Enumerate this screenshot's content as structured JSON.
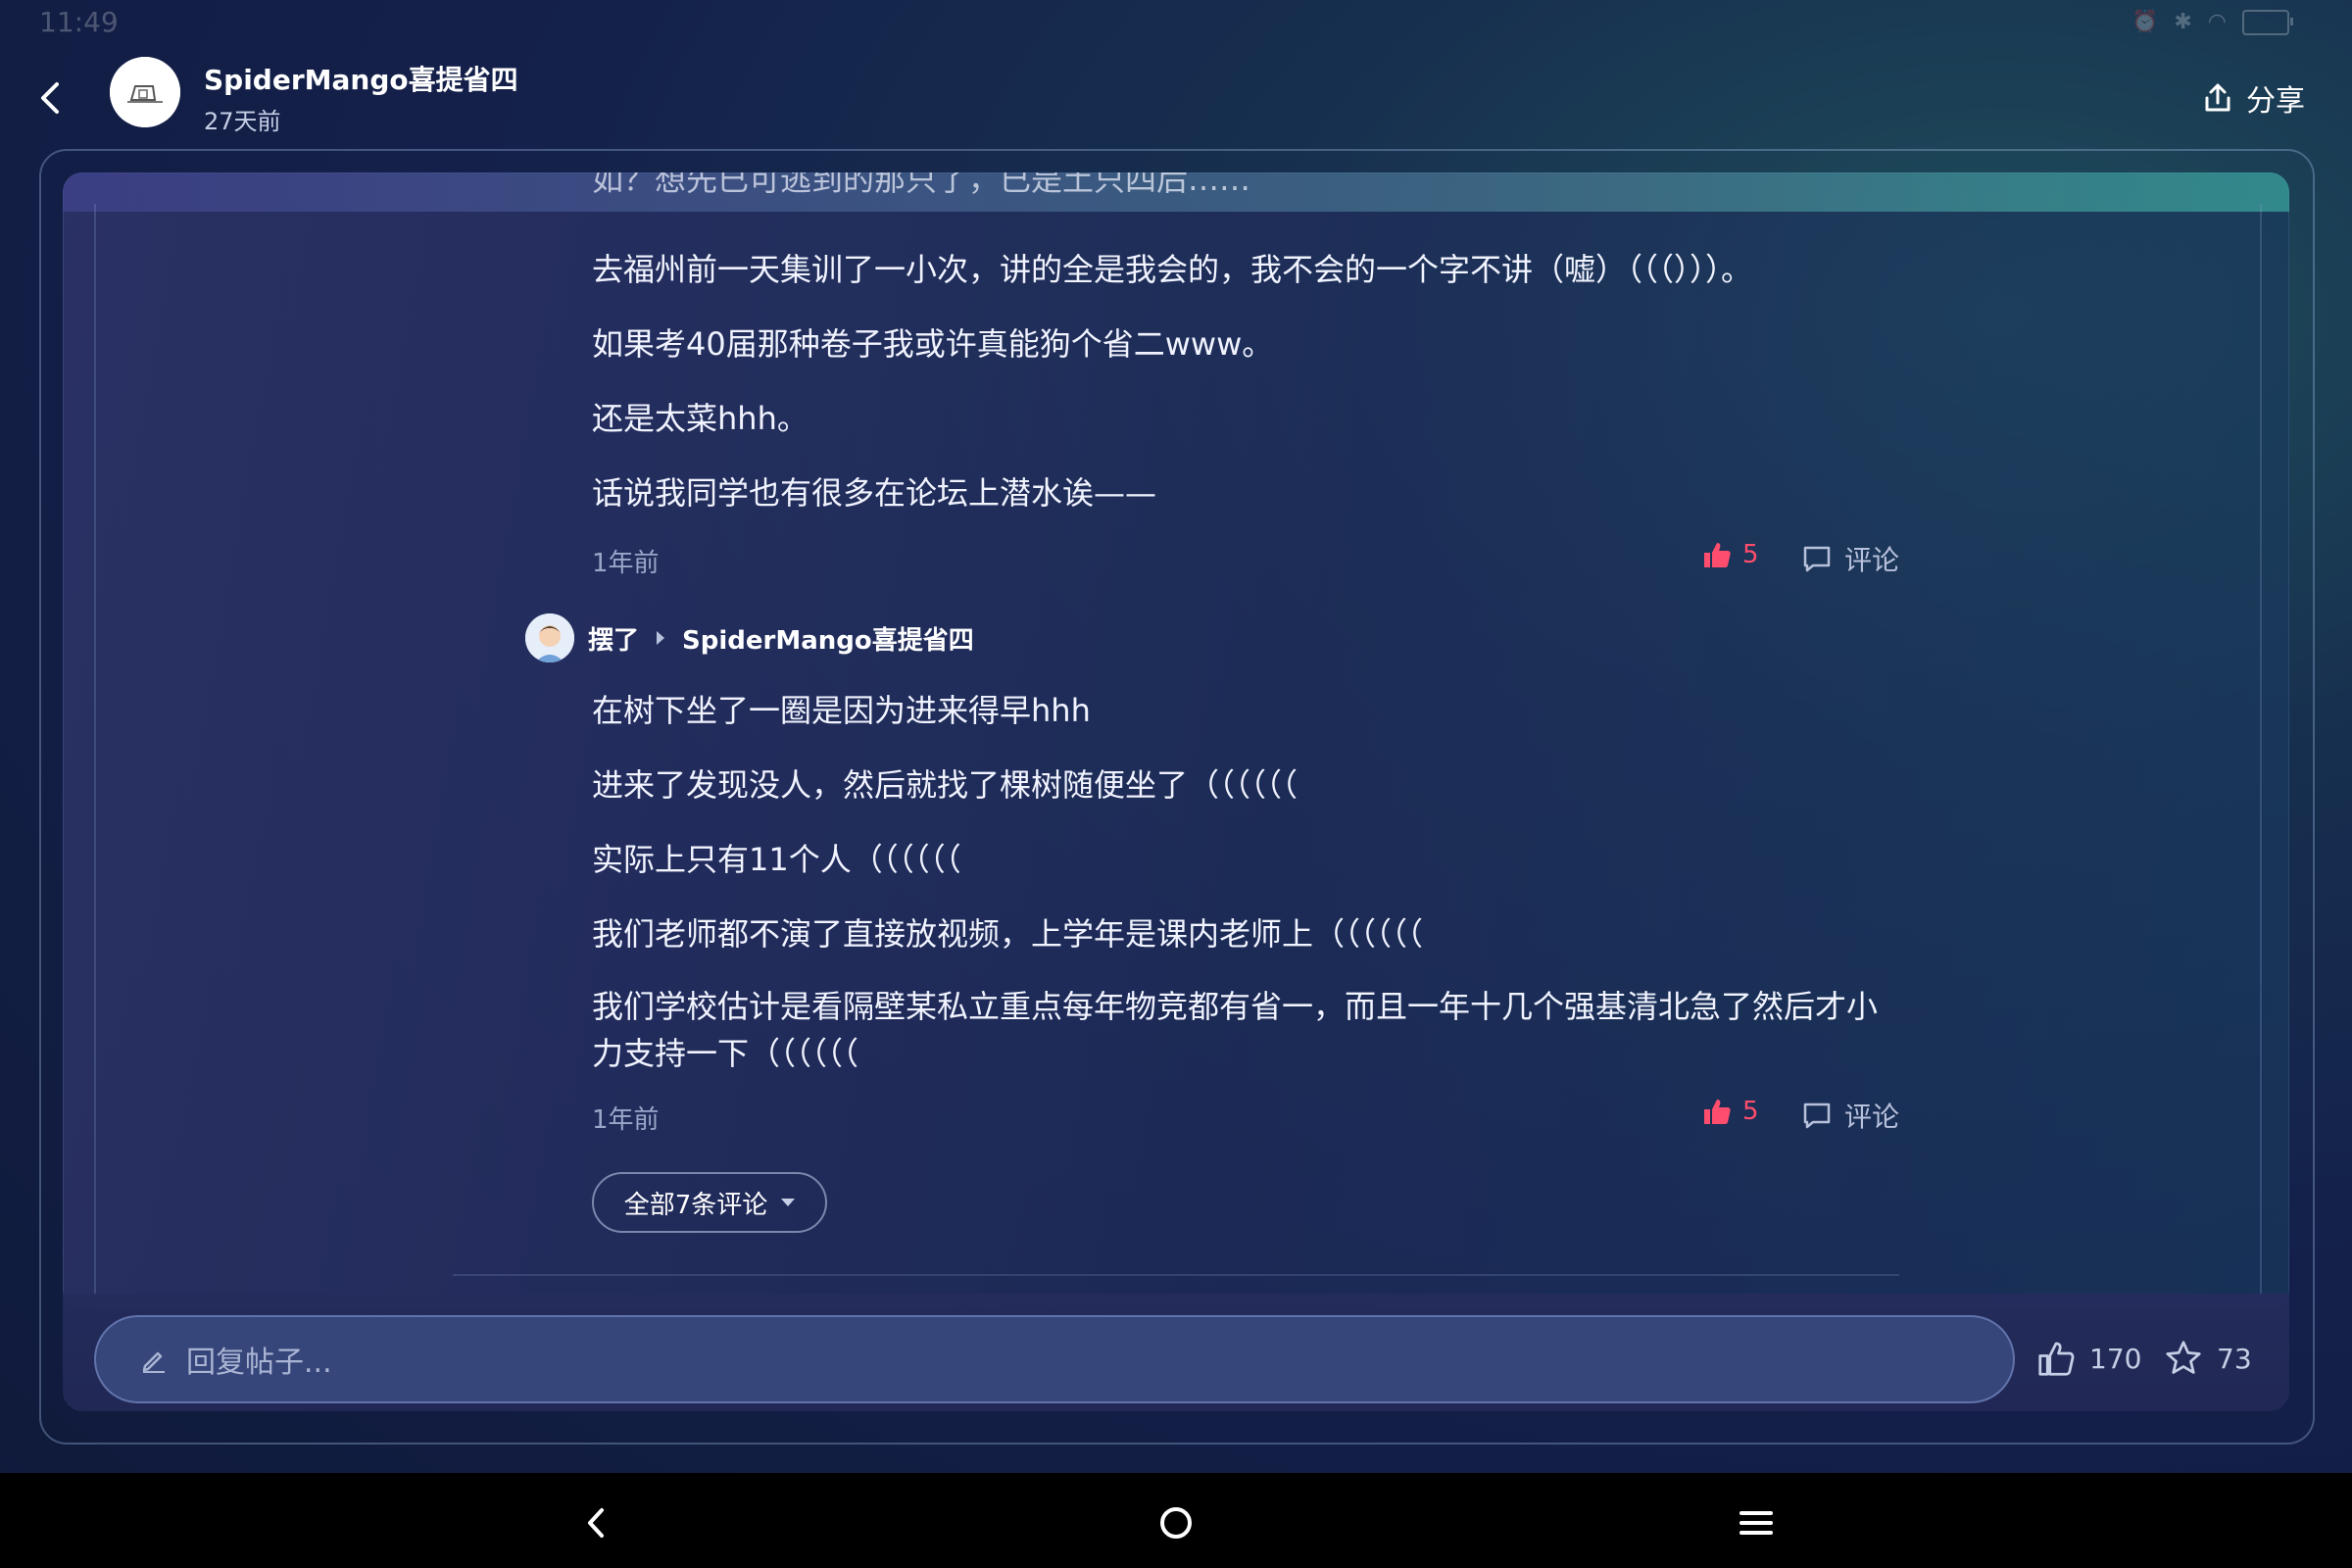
{
  "status": {
    "time": "11:49"
  },
  "header": {
    "author": "SpiderMango喜提省四",
    "time_ago": "27天前",
    "share_label": "分享"
  },
  "comment1": {
    "cut_line": "如？想先已可逃到的那只了，已是土只四后……",
    "lines": [
      "去福州前一天集训了一小次，讲的全是我会的，我不会的一个字不讲（嘘）（（（）））。",
      "如果考40届那种卷子我或许真能狗个省二www。",
      "还是太菜hhh。",
      "话说我同学也有很多在论坛上潜水诶——"
    ],
    "time": "1年前",
    "likes": "5",
    "comment_label": "评论"
  },
  "comment2": {
    "user": "摆了",
    "reply_to": "SpiderMango喜提省四",
    "lines": [
      "在树下坐了一圈是因为进来得早hhh",
      "进来了发现没人，然后就找了棵树随便坐了（（（（（（",
      "实际上只有11个人（（（（（（",
      "我们老师都不演了直接放视频，上学年是课内老师上（（（（（（",
      "我们学校估计是看隔壁某私立重点每年物竞都有省一，而且一年十几个强基清北急了然后才小",
      "力支持一下（（（（（（"
    ],
    "time": "1年前",
    "likes": "5",
    "comment_label": "评论"
  },
  "all_comments_label": "全部7条评论",
  "bottom": {
    "reply_placeholder": "回复帖子...",
    "like_count": "170",
    "star_count": "73"
  },
  "colors": {
    "like_red": "#ff4d6d",
    "accent_teal": "#3fb6b0"
  }
}
